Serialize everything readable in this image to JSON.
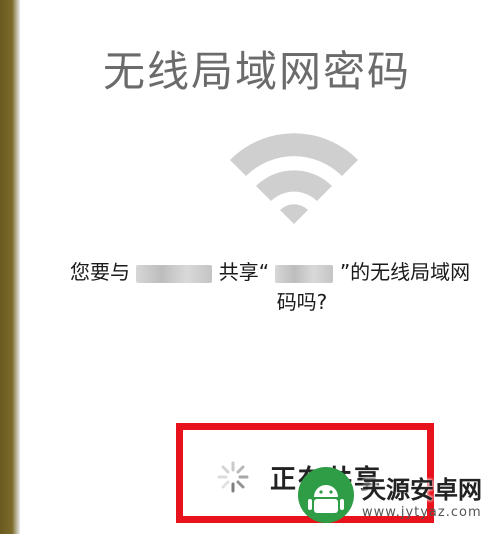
{
  "dialog": {
    "title": "无线局域网密码",
    "message_part1": "您要与",
    "message_part2": "共享“",
    "message_part3": "”的无线局域网",
    "message_line2": "码吗?",
    "sharing_label": "正在共享"
  },
  "watermark": {
    "brand": "天源安卓网",
    "url": "www.jytyaz.com"
  },
  "colors": {
    "highlight_border": "#e8121c",
    "title_text": "#6b6b6b",
    "wifi_icon": "#cfcfcf",
    "watermark_green": "#2e9d45"
  },
  "icons": {
    "wifi": "wifi-icon",
    "spinner": "loading-spinner-icon",
    "logo": "android-logo-icon"
  }
}
